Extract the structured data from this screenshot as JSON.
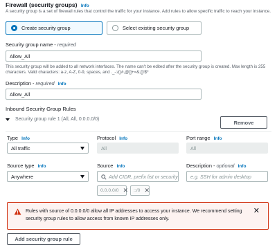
{
  "firewall": {
    "title": "Firewall (security groups)",
    "info": "Info",
    "description": "A security group is a set of firewall rules that control the traffic for your instance. Add rules to allow specific traffic to reach your instance.",
    "options": {
      "create": "Create security group",
      "existing": "Select existing security group"
    },
    "selected": "create"
  },
  "sg_name": {
    "label": "Security group name - ",
    "required": "required",
    "value": "Allow_All",
    "hint": "This security group will be added to all network interfaces. The name can't be edited after the security group is created. Max length is 255 characters. Valid characters: a-z, A-Z, 0-9, spaces, and ._-:/()#,@[]+=&;{}!$*"
  },
  "sg_description": {
    "label": "Description - ",
    "required": "required",
    "info": "Info",
    "value": "Allow_All"
  },
  "inbound": {
    "heading": "Inbound Security Group Rules",
    "rule_title": "Security group rule 1 (All, All, 0.0.0.0/0)",
    "remove_label": "Remove",
    "type": {
      "label": "Type",
      "info": "Info",
      "value": "All traffic"
    },
    "protocol": {
      "label": "Protocol",
      "info": "Info",
      "value": "All"
    },
    "port_range": {
      "label": "Port range",
      "info": "Info",
      "value": "All"
    },
    "source_type": {
      "label": "Source type",
      "info": "Info",
      "value": "Anywhere"
    },
    "source": {
      "label": "Source",
      "info": "Info",
      "placeholder": "Add CIDR, prefix list or security",
      "chips": [
        "0.0.0.0/0",
        "::/0"
      ]
    },
    "rule_description": {
      "label": "Description - ",
      "optional": "optional",
      "info": "Info",
      "placeholder": "e.g. SSH for admin desktop"
    }
  },
  "warning": {
    "text": "Rules with source of 0.0.0.0/0 allow all IP addresses to access your instance. We recommend setting security group rules to allow access from known IP addresses only."
  },
  "add_rule_label": "Add security group rule",
  "colors": {
    "accent": "#0073bb",
    "warning_border": "#d13212",
    "warning_bg": "#fdf3f1"
  }
}
